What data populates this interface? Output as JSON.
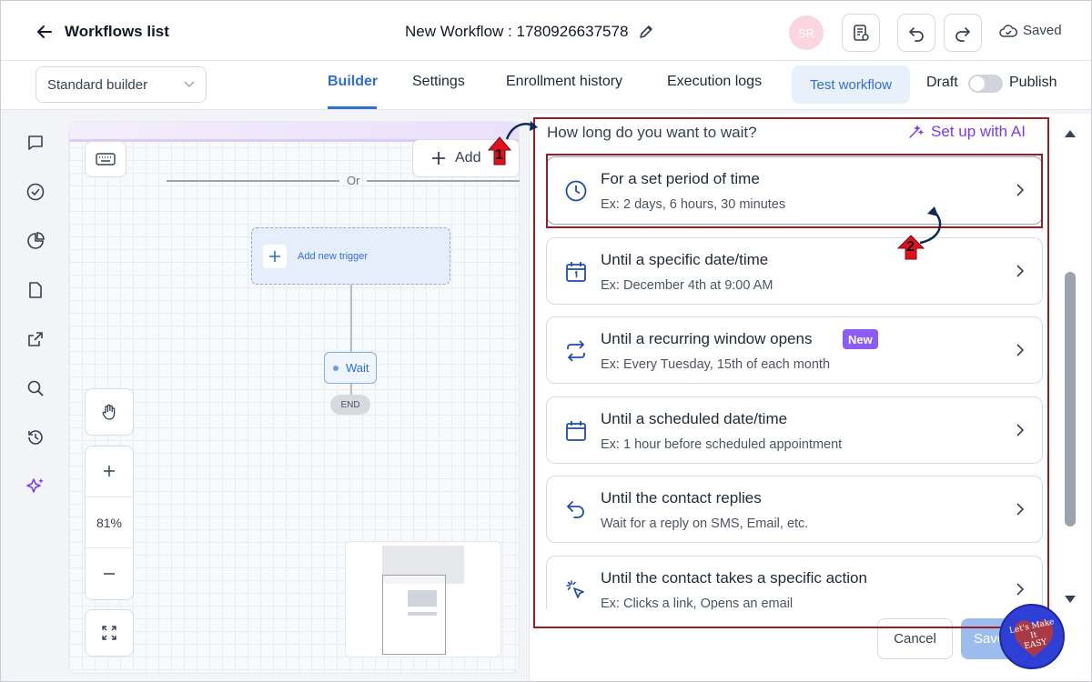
{
  "header": {
    "back_label": "Workflows list",
    "title": "New Workflow : 1780926637578",
    "avatar_initials": "SR",
    "saved_label": "Saved"
  },
  "subheader": {
    "builder_select": "Standard builder",
    "tabs": [
      "Builder",
      "Settings",
      "Enrollment history",
      "Execution logs"
    ],
    "active_tab": "Builder",
    "test_button": "Test workflow",
    "draft_label": "Draft",
    "publish_label": "Publish",
    "publish_on": false
  },
  "sidebar": {
    "icons": [
      "chat-icon",
      "check-circle-icon",
      "pie-chart-icon",
      "document-icon",
      "external-link-icon",
      "search-icon",
      "history-icon",
      "sparkle-icon"
    ]
  },
  "canvas": {
    "add_label": "Add",
    "or_label": "Or",
    "trigger_label": "Add new trigger",
    "wait_label": "Wait",
    "end_label": "END",
    "zoom": "81%"
  },
  "panel": {
    "question": "How long do you want to wait?",
    "ai_label": "Set up with AI",
    "options": [
      {
        "title": "For a set period of time",
        "subtitle": "Ex: 2 days, 6 hours, 30 minutes",
        "icon": "clock-icon"
      },
      {
        "title": "Until a specific date/time",
        "subtitle": "Ex: December 4th at 9:00 AM",
        "icon": "calendar-day-icon"
      },
      {
        "title": "Until a recurring window opens",
        "subtitle": "Ex: Every Tuesday, 15th of each month",
        "icon": "repeat-icon",
        "badge": "New"
      },
      {
        "title": "Until a scheduled date/time",
        "subtitle": "Ex: 1 hour before scheduled appointment",
        "icon": "calendar-icon"
      },
      {
        "title": "Until the contact replies",
        "subtitle": "Wait for a reply on SMS, Email, etc.",
        "icon": "reply-icon"
      },
      {
        "title": "Until the contact takes a specific action",
        "subtitle": "Ex: Clicks a link, Opens an email",
        "icon": "cursor-click-icon"
      }
    ],
    "cancel_label": "Cancel",
    "save_label": "Save"
  },
  "annotations": {
    "step1": "1",
    "step2": "2",
    "watermark_lines": [
      "Let's Make",
      "It",
      "EASY"
    ]
  },
  "colors": {
    "accent": "#2f6fd6",
    "purple": "#7c3aed",
    "annotation_red": "#9b1c24",
    "badge": "#8b5cf6"
  }
}
